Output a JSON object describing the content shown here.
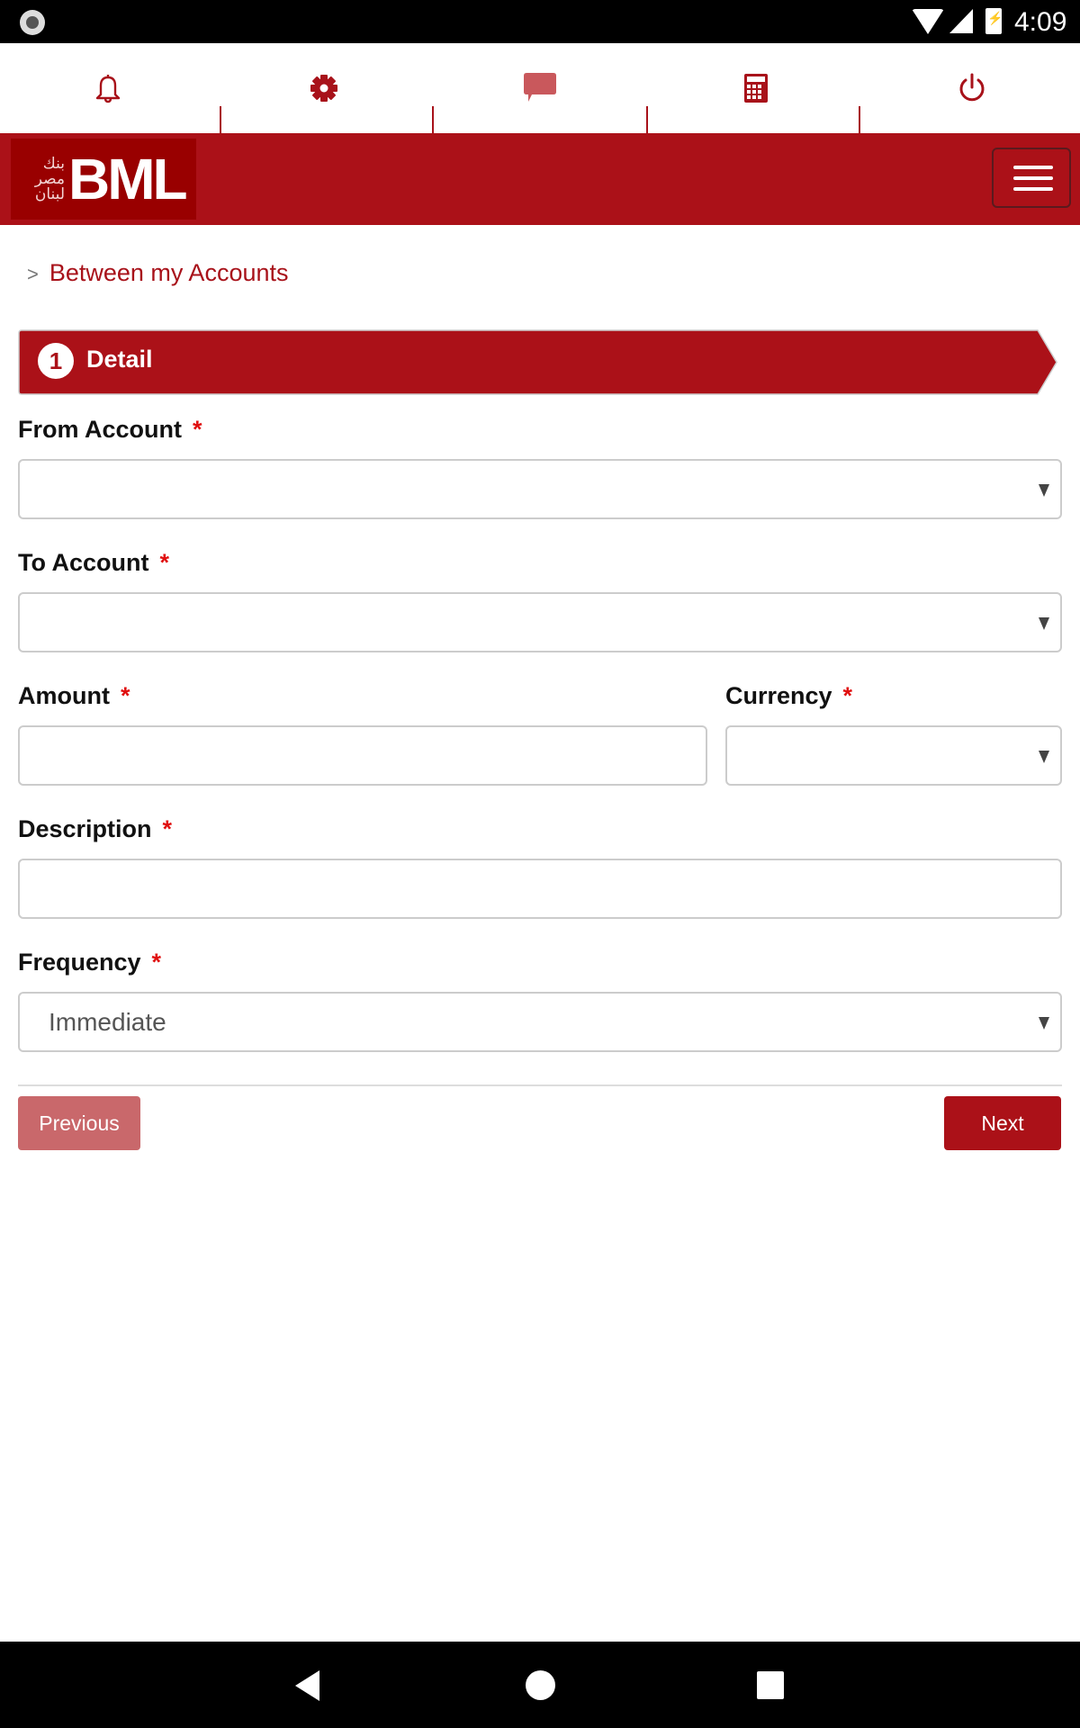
{
  "status_bar": {
    "time": "4:09",
    "icons": [
      "screen-record-icon",
      "wifi-icon",
      "cell-signal-icon",
      "battery-charging-icon"
    ]
  },
  "top_icons": [
    {
      "name": "notifications",
      "icon": "bell-icon"
    },
    {
      "name": "settings",
      "icon": "gear-icon"
    },
    {
      "name": "messages",
      "icon": "chat-bubble-icon"
    },
    {
      "name": "calculator",
      "icon": "calculator-icon"
    },
    {
      "name": "logout",
      "icon": "power-icon"
    }
  ],
  "header": {
    "logo_arabic": "بنك مصر لبنان",
    "logo_text": "BML",
    "menu_icon": "hamburger-icon"
  },
  "breadcrumb": {
    "separator": ">",
    "current": "Between my Accounts"
  },
  "colors": {
    "brand_red": "#ab1118",
    "required_star": "#e01010",
    "prev_button": "#c9686b"
  },
  "step": {
    "number": "1",
    "label": "Detail"
  },
  "form": {
    "required_mark": "*",
    "from_account": {
      "label": "From Account",
      "value": ""
    },
    "to_account": {
      "label": "To Account",
      "value": ""
    },
    "amount": {
      "label": "Amount",
      "value": ""
    },
    "currency": {
      "label": "Currency",
      "value": ""
    },
    "description": {
      "label": "Description",
      "value": ""
    },
    "frequency": {
      "label": "Frequency",
      "value": "Immediate"
    }
  },
  "buttons": {
    "previous": "Previous",
    "next": "Next"
  },
  "nav_bar": {
    "back": "back-icon",
    "home": "home-icon",
    "recents": "recents-icon"
  }
}
